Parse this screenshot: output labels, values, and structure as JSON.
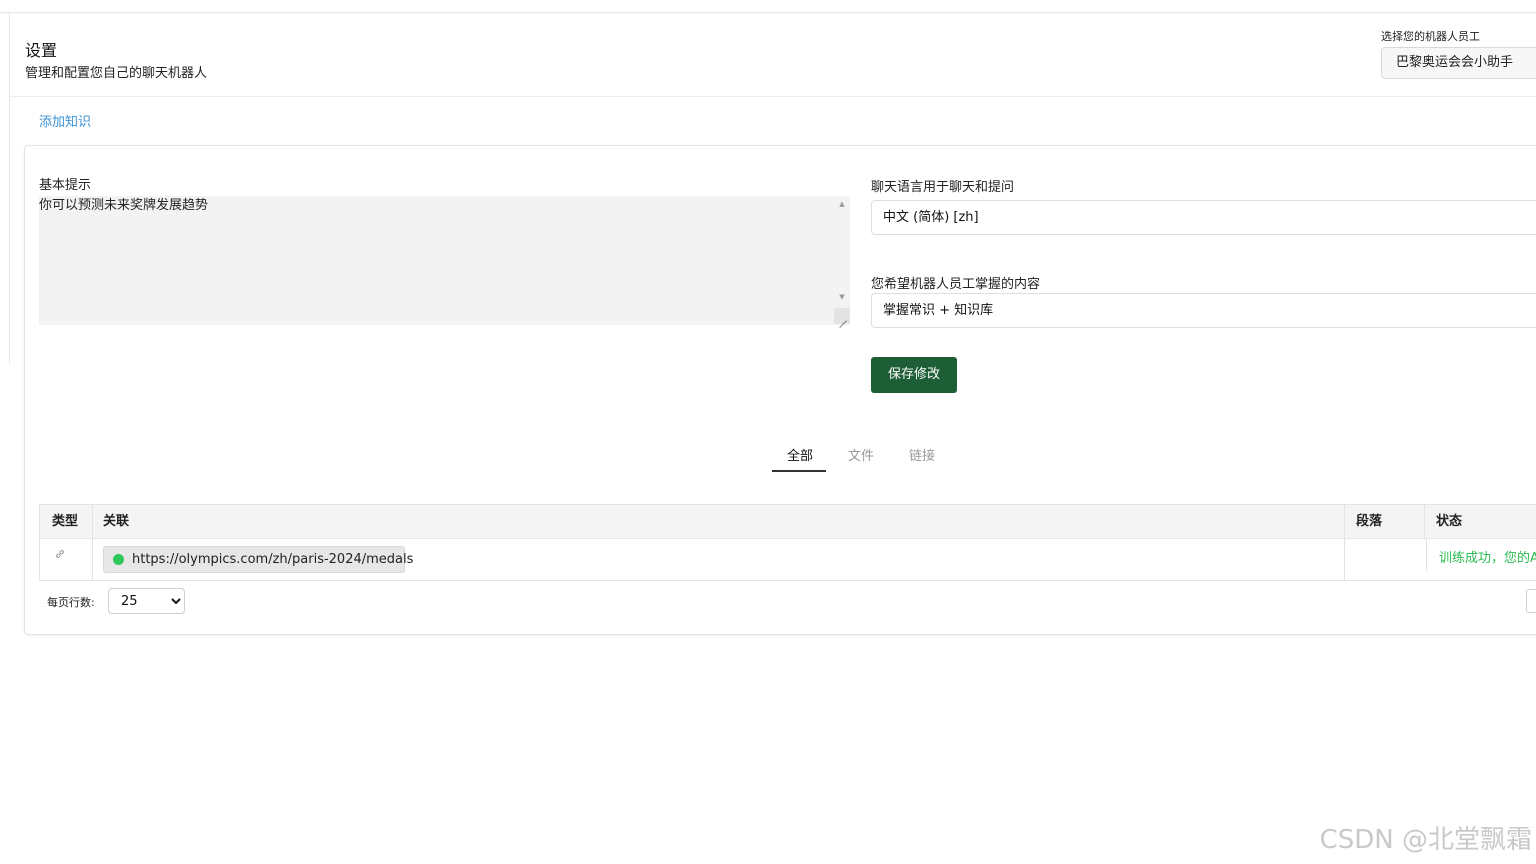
{
  "header": {
    "title": "设置",
    "subtitle": "管理和配置您自己的聊天机器人"
  },
  "bot_selector": {
    "label": "选择您的机器人员工",
    "value": "巴黎奥运会会小助手"
  },
  "add_knowledge_label": "添加知识",
  "settings": {
    "prompt_label": "基本提示",
    "prompt_value": "你可以预测未来奖牌发展趋势",
    "language_label": "聊天语言用于聊天和提问",
    "language_value": "中文 (简体) [zh]",
    "knowledge_label": "您希望机器人员工掌握的内容",
    "knowledge_value": "掌握常识 + 知识库",
    "save_label": "保存修改"
  },
  "tabs": [
    {
      "label": "全部",
      "active": true
    },
    {
      "label": "文件",
      "active": false
    },
    {
      "label": "链接",
      "active": false
    }
  ],
  "table": {
    "headers": [
      "类型",
      "关联",
      "段落",
      "状态"
    ],
    "rows": [
      {
        "type_icon": "link-icon",
        "link": "https://olympics.com/zh/paris-2024/medals",
        "paragraphs": "",
        "status": "训练成功，您的A"
      }
    ]
  },
  "pagination": {
    "rows_per_page_label": "每页行数:",
    "rows_per_page_value": "25",
    "rows_per_page_options": [
      "25"
    ]
  },
  "watermark": "CSDN @北堂飘霜",
  "colors": {
    "primary_button": "#1d5e36",
    "link": "#3a93d6",
    "success": "#2dbb53"
  }
}
